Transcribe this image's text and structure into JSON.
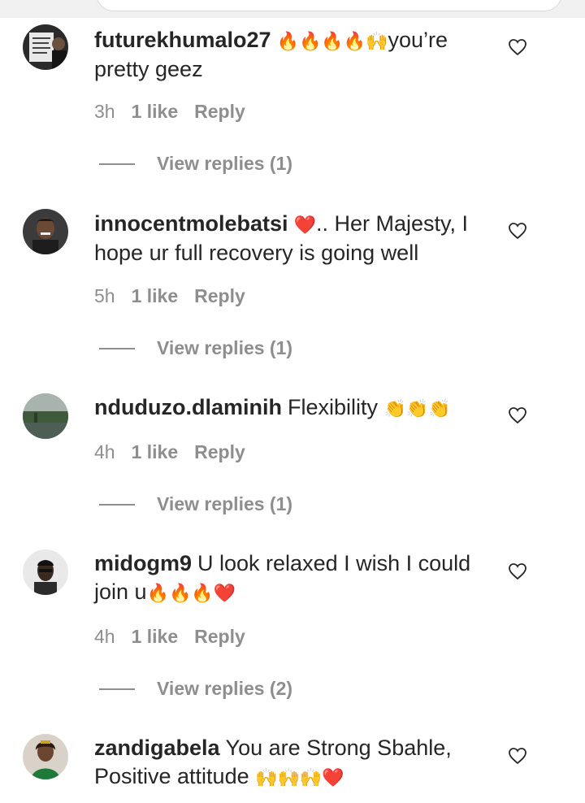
{
  "comments": [
    {
      "username": "futurekhumalo27",
      "text": "you’re pretty geez",
      "emojis_before": "🔥🔥🔥🔥🙌",
      "time": "3h",
      "likes": "1 like",
      "reply": "Reply",
      "view_replies": "View replies (1)"
    },
    {
      "username": "innocentmolebatsi",
      "emoji_lead": "❤️",
      "text": ".. Her Majesty, I hope ur full recovery is going well",
      "time": "5h",
      "likes": "1 like",
      "reply": "Reply",
      "view_replies": "View replies (1)"
    },
    {
      "username": "nduduzo.dlaminih",
      "text": "Flexibility",
      "emojis_after": "👏👏👏",
      "time": "4h",
      "likes": "1 like",
      "reply": "Reply",
      "view_replies": "View replies (1)"
    },
    {
      "username": "midogm9",
      "text": "U look relaxed I wish I could join u",
      "emojis_after": "🔥🔥🔥❤️",
      "time": "4h",
      "likes": "1 like",
      "reply": "Reply",
      "view_replies": "View replies (2)"
    },
    {
      "username": "zandigabela",
      "text": "You are Strong Sbahle, Positive attitude",
      "emojis_after": "🙌🙌🙌❤️",
      "time": "",
      "likes": "",
      "reply": "",
      "view_replies": ""
    }
  ],
  "colors": {
    "text": "#262626",
    "secondary": "#8e8e8e",
    "background": "#ffffff"
  },
  "icons": {
    "like": "heart-outline-icon"
  }
}
